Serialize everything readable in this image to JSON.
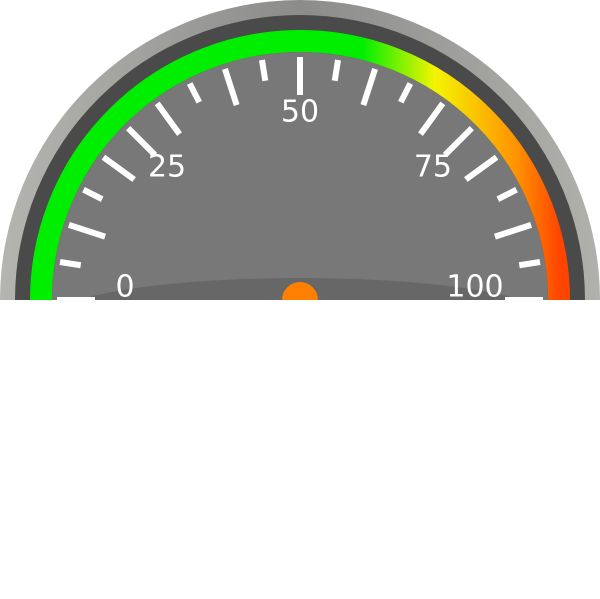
{
  "gauge": {
    "min": 0,
    "max": 100,
    "value": 0,
    "labels": [
      {
        "value": 0,
        "text": "0"
      },
      {
        "value": 25,
        "text": "25"
      },
      {
        "value": 50,
        "text": "50"
      },
      {
        "value": 75,
        "text": "75"
      },
      {
        "value": 100,
        "text": "100"
      }
    ],
    "major_ticks": [
      0,
      25,
      50,
      75,
      100
    ],
    "minor_ticks": [
      5,
      10,
      15,
      20,
      30,
      35,
      40,
      45,
      55,
      60,
      65,
      70,
      80,
      85,
      90,
      95
    ],
    "colors": {
      "face": "#787878",
      "outer_bezel": "#9a9a98",
      "inner_bezel": "#4a4a4a",
      "needle_pivot": "#ff7f00",
      "band_green": "#00ee00",
      "band_yellow": "#f4f400",
      "band_orange": "#ff9000",
      "band_red": "#ff4400"
    }
  }
}
